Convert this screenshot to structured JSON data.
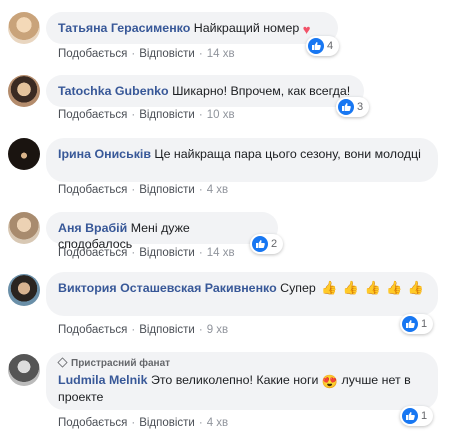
{
  "actions": {
    "like": "Подобається",
    "reply": "Відповісти",
    "sep": "·"
  },
  "comments": [
    {
      "author": "Татьяна Герасименко",
      "text": "Найкращий номер",
      "time": "14 хв",
      "reactions": "4"
    },
    {
      "author": "Tatochka Gubenko",
      "text": "Шикарно! Впрочем, как всегда!",
      "time": "10 хв",
      "reactions": "3"
    },
    {
      "author": "Ірина Ониськів",
      "text": "Це найкраща пара цього сезону, вони молодці",
      "time": "4 хв"
    },
    {
      "author": "Аня Врабій",
      "text": "Мені дуже сподобалось",
      "time": "14 хв",
      "reactions": "2"
    },
    {
      "author": "Виктория Осташевская Ракивненко",
      "text": "Супер",
      "time": "9 хв",
      "reactions": "1"
    },
    {
      "badge": "Пристрасний фанат",
      "author": "Ludmila Melnik",
      "text_a": "Это великолепно! Какие ноги",
      "text_b": "лучше нет в проекте",
      "time": "4 хв",
      "reactions": "1"
    }
  ],
  "colors": {
    "link": "#385898",
    "like_blue": "#1877f2",
    "bubble": "#f2f3f5"
  }
}
